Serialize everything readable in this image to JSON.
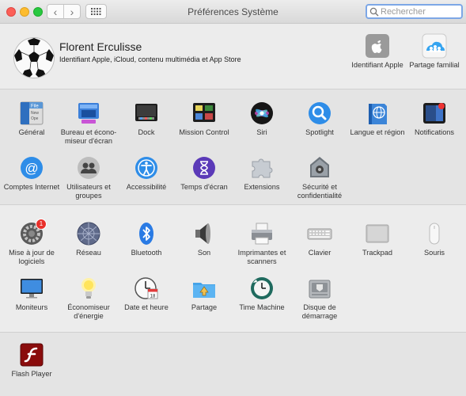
{
  "window": {
    "title": "Préférences Système"
  },
  "toolbar": {
    "back": "‹",
    "forward": "›",
    "search_placeholder": "Rechercher"
  },
  "user": {
    "name": "Florent Erculisse",
    "subtitle": "Identifiant Apple, iCloud, contenu multimédia et App Store",
    "panes": [
      {
        "label": "Identifiant Apple",
        "icon": "apple-id-icon"
      },
      {
        "label": "Partage familial",
        "icon": "family-sharing-icon"
      }
    ]
  },
  "section1": [
    {
      "label": "Général",
      "icon": "general-icon"
    },
    {
      "label": "Bureau et écono-miseur d'écran",
      "icon": "desktop-screensaver-icon"
    },
    {
      "label": "Dock",
      "icon": "dock-icon"
    },
    {
      "label": "Mission Control",
      "icon": "mission-control-icon"
    },
    {
      "label": "Siri",
      "icon": "siri-icon"
    },
    {
      "label": "Spotlight",
      "icon": "spotlight-icon"
    },
    {
      "label": "Langue et région",
      "icon": "language-region-icon"
    },
    {
      "label": "Notifications",
      "icon": "notifications-icon"
    },
    {
      "label": "Comptes Internet",
      "icon": "internet-accounts-icon"
    },
    {
      "label": "Utilisateurs et groupes",
      "icon": "users-groups-icon"
    },
    {
      "label": "Accessibilité",
      "icon": "accessibility-icon"
    },
    {
      "label": "Temps d'écran",
      "icon": "screen-time-icon"
    },
    {
      "label": "Extensions",
      "icon": "extensions-icon"
    },
    {
      "label": "Sécurité et confidentialité",
      "icon": "security-privacy-icon"
    }
  ],
  "section2": [
    {
      "label": "Mise à jour de logiciels",
      "icon": "software-update-icon",
      "badge": "1"
    },
    {
      "label": "Réseau",
      "icon": "network-icon"
    },
    {
      "label": "Bluetooth",
      "icon": "bluetooth-icon"
    },
    {
      "label": "Son",
      "icon": "sound-icon"
    },
    {
      "label": "Imprimantes et scanners",
      "icon": "printers-scanners-icon"
    },
    {
      "label": "Clavier",
      "icon": "keyboard-icon"
    },
    {
      "label": "Trackpad",
      "icon": "trackpad-icon"
    },
    {
      "label": "Souris",
      "icon": "mouse-icon"
    },
    {
      "label": "Moniteurs",
      "icon": "displays-icon"
    },
    {
      "label": "Économiseur d'énergie",
      "icon": "energy-saver-icon"
    },
    {
      "label": "Date et heure",
      "icon": "date-time-icon"
    },
    {
      "label": "Partage",
      "icon": "sharing-icon"
    },
    {
      "label": "Time Machine",
      "icon": "time-machine-icon"
    },
    {
      "label": "Disque de démarrage",
      "icon": "startup-disk-icon"
    }
  ],
  "section3": [
    {
      "label": "Flash Player",
      "icon": "flash-player-icon"
    }
  ]
}
